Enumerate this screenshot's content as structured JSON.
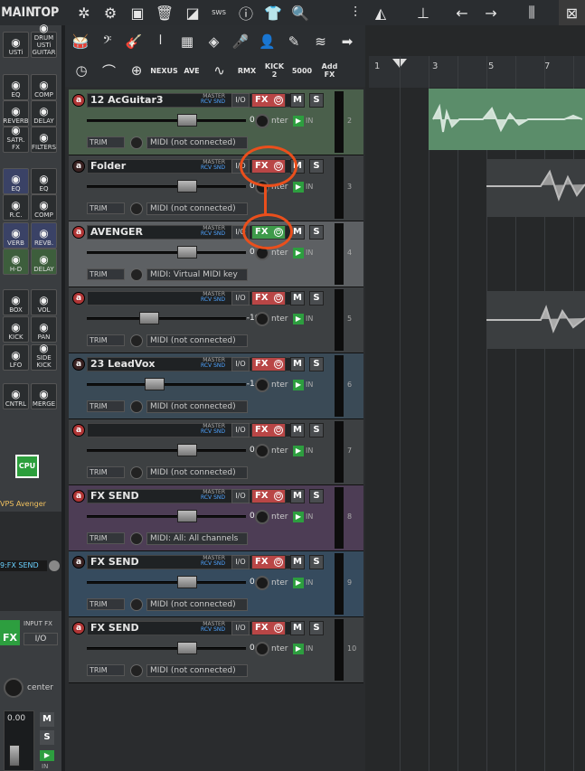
{
  "toolbar": {
    "main_label": "MAIN",
    "top_label": "TOP",
    "sws_label": "SWS"
  },
  "left_panel": {
    "rows": [
      [
        "USTi",
        "DRUM USTi GUITAR"
      ],
      [
        "EQ",
        "COMP"
      ],
      [
        "REVERB",
        "DELAY"
      ],
      [
        "SATR. FX",
        "FILTERS"
      ],
      [
        "EQ",
        "EQ"
      ],
      [
        "R.C.",
        "COMP"
      ],
      [
        "VERB",
        "REVB."
      ],
      [
        "H-D",
        "DELAY"
      ],
      [
        "BOX",
        "VOL"
      ],
      [
        "KICK",
        "PAN"
      ],
      [
        "LFO",
        "SIDE KICK"
      ],
      [
        "CNTRL",
        "MERGE"
      ]
    ],
    "cpu_label": "CPU",
    "vps_label": "VPS Avenger",
    "send_label": "9:FX SEND",
    "fx_label": "FX",
    "inputfx_label": "INPUT FX",
    "io_label": "I/O",
    "center_label": "center",
    "master_vol": "0.00",
    "m_label": "M",
    "s_label": "S",
    "in_label": "IN"
  },
  "fx_toolbar": {
    "nexus_label": "NEXUS",
    "ave_label": "AVE",
    "rmx_label": "RMX",
    "kick2_label": "KICK 2",
    "k5000_label": "5000",
    "addfx_label": "Add FX"
  },
  "ruler": {
    "marks": [
      "1",
      "3",
      "5",
      "7"
    ]
  },
  "tracks": [
    {
      "name": "12  AcGuitar3",
      "vol": "0.00",
      "midi": "MIDI (not connected)",
      "num": "2",
      "fx_state": "red",
      "bg": "#4a5f4b"
    },
    {
      "name": "Folder",
      "vol": "0.00",
      "midi": "MIDI (not connected)",
      "num": "3",
      "fx_state": "red",
      "bg": "#3d4042"
    },
    {
      "name": "AVENGER",
      "vol": "0.00",
      "midi": "MIDI: Virtual MIDI key",
      "num": "4",
      "fx_state": "green",
      "bg": "#5d6063"
    },
    {
      "name": "",
      "vol": "-16.4",
      "midi": "MIDI (not connected)",
      "num": "5",
      "fx_state": "red",
      "bg": "#3d4042"
    },
    {
      "name": "23  LeadVox",
      "vol": "-14.6",
      "midi": "MIDI (not connected)",
      "num": "6",
      "fx_state": "red",
      "bg": "#3a4a56"
    },
    {
      "name": "",
      "vol": "0.00",
      "midi": "MIDI (not connected)",
      "num": "7",
      "fx_state": "red",
      "bg": "#3d4042"
    },
    {
      "name": "FX SEND",
      "vol": "0.00",
      "midi": "MIDI: All: All channels",
      "num": "8",
      "fx_state": "red",
      "bg": "#4d3d55"
    },
    {
      "name": "FX SEND",
      "vol": "0.00",
      "midi": "MIDI (not connected)",
      "num": "9",
      "fx_state": "red",
      "bg": "#364b5e"
    },
    {
      "name": "FX SEND",
      "vol": "0.00",
      "midi": "MIDI (not connected)",
      "num": "10",
      "fx_state": "red",
      "bg": "#3d4042"
    }
  ],
  "track_labels": {
    "io": "I/O",
    "fx": "FX",
    "m": "M",
    "s": "S",
    "master": "MASTER",
    "rcv": "RCV",
    "snd": "SND",
    "input": "INPUT",
    "trim": "TRIM",
    "pan_text": "nter",
    "in": "IN"
  },
  "colors": {
    "annotation": "#ea4f1c",
    "fx_off": "#b94646",
    "fx_on": "#3e9a4a",
    "item": "#5b8d6a"
  }
}
